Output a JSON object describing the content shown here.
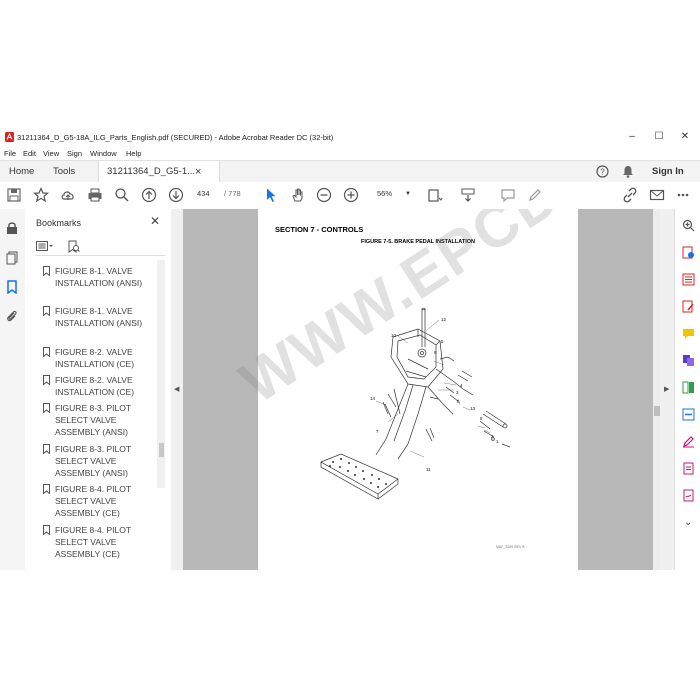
{
  "window": {
    "title": "31211364_D_G5-18A_ILG_Parts_English.pdf (SECURED) - Adobe Acrobat Reader DC (32-bit)",
    "controls": {
      "minimize": "–",
      "maximize": "☐",
      "close": "✕"
    }
  },
  "menu": [
    "File",
    "Edit",
    "View",
    "Sign",
    "Window",
    "Help"
  ],
  "tabs": {
    "home": "Home",
    "tools": "Tools",
    "document": "31211364_D_G5-1...",
    "doc_close": "×",
    "sign_in": "Sign In"
  },
  "toolbar": {
    "page_current": "434",
    "page_total": "/ 778",
    "zoom": "56%"
  },
  "bookmarks": {
    "title": "Bookmarks",
    "close": "✕",
    "items": [
      "FIGURE 8-1. VALVE INSTALLATION (ANSI)",
      "FIGURE 8-1. VALVE INSTALLATION (ANSI)",
      "FIGURE 8-2. VALVE INSTALLATION (CE)",
      "FIGURE 8-2. VALVE INSTALLATION (CE)",
      "FIGURE 8-3. PILOT SELECT VALVE ASSEMBLY (ANSI)",
      "FIGURE 8-3. PILOT SELECT VALVE ASSEMBLY (ANSI)",
      "FIGURE 8-4. PILOT SELECT VALVE ASSEMBLY (CE)",
      "FIGURE 8-4. PILOT SELECT VALVE ASSEMBLY (CE)"
    ]
  },
  "page": {
    "section": "SECTION 7 - CONTROLS",
    "figure_title": "FIGURE 7-5. BRAKE PEDAL INSTALLATION",
    "callouts": [
      "12",
      "10",
      "9",
      "5",
      "4",
      "3",
      "6",
      "13",
      "14",
      "7",
      "2",
      "8",
      "1",
      "11"
    ],
    "footer": "MAF_2089 REV B"
  },
  "watermark": "WWW.EPCDEPO.COM",
  "colors": {
    "accent_blue": "#1473e6",
    "acrobat_red": "#e02020",
    "panel_bg": "#f5f5f5",
    "doc_bg": "#b8b8b8"
  }
}
